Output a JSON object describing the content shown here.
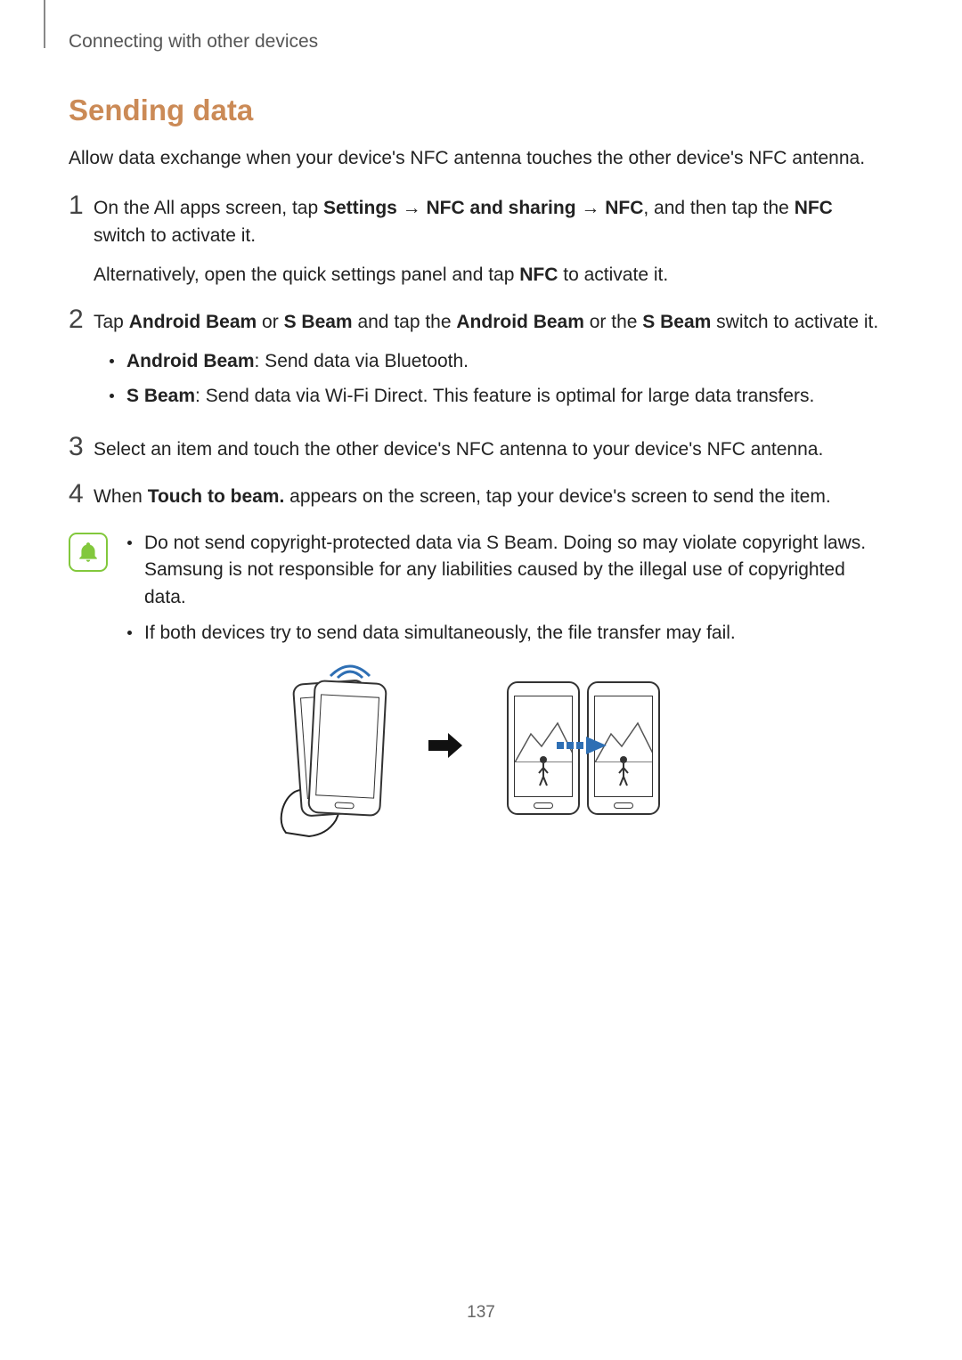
{
  "header": {
    "breadcrumb": "Connecting with other devices"
  },
  "section": {
    "title": "Sending data",
    "intro": "Allow data exchange when your device's NFC antenna touches the other device's NFC antenna."
  },
  "steps": {
    "s1": {
      "num": "1",
      "p1_a": "On the All apps screen, tap ",
      "p1_b_settings": "Settings",
      "p1_arrow1": " → ",
      "p1_b_nfc_sharing": "NFC and sharing",
      "p1_arrow2": " → ",
      "p1_b_nfc": "NFC",
      "p1_c": ", and then tap the ",
      "p1_b_nfc_switch": "NFC",
      "p1_d": " switch to activate it.",
      "p2_a": "Alternatively, open the quick settings panel and tap ",
      "p2_b_nfc": "NFC",
      "p2_c": " to activate it."
    },
    "s2": {
      "num": "2",
      "p1_a": "Tap ",
      "p1_b_ab": "Android Beam",
      "p1_b_or": " or ",
      "p1_b_sb": "S Beam",
      "p1_c": " and tap the ",
      "p1_b_ab2": "Android Beam",
      "p1_d": " or the ",
      "p1_b_sb2": "S Beam",
      "p1_e": " switch to activate it.",
      "bullet1_b": "Android Beam",
      "bullet1_t": ": Send data via Bluetooth.",
      "bullet2_b": "S Beam",
      "bullet2_t": ": Send data via Wi-Fi Direct. This feature is optimal for large data transfers."
    },
    "s3": {
      "num": "3",
      "p1": "Select an item and touch the other device's NFC antenna to your device's NFC antenna."
    },
    "s4": {
      "num": "4",
      "p1_a": "When ",
      "p1_b": "Touch to beam.",
      "p1_c": " appears on the screen, tap your device's screen to send the item."
    }
  },
  "note": {
    "bullet1": "Do not send copyright-protected data via S Beam. Doing so may violate copyright laws. Samsung is not responsible for any liabilities caused by the illegal use of copyrighted data.",
    "bullet2": "If both devices try to send data simultaneously, the file transfer may fail."
  },
  "page_number": "137"
}
